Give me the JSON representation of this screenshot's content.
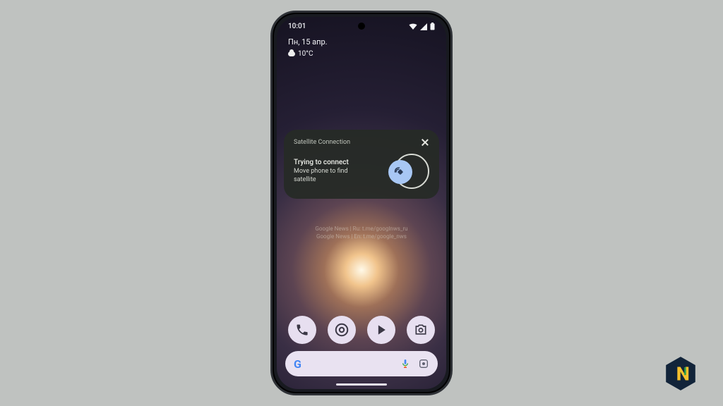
{
  "status_bar": {
    "time": "10:01"
  },
  "date_widget": {
    "date": "Пн, 15 апр.",
    "temperature": "10°C"
  },
  "satellite_card": {
    "title": "Satellite Connection",
    "status": "Trying to connect",
    "hint": "Move phone to find satellite"
  },
  "watermark": {
    "line1": "Google News | Ru: t.me/googlnws_ru",
    "line2": "Google News | En: t.me/google_nws"
  },
  "dock": {
    "phone": "Phone",
    "chrome": "Chrome",
    "play": "Play Store",
    "camera": "Camera"
  },
  "search": {
    "provider": "Google"
  }
}
